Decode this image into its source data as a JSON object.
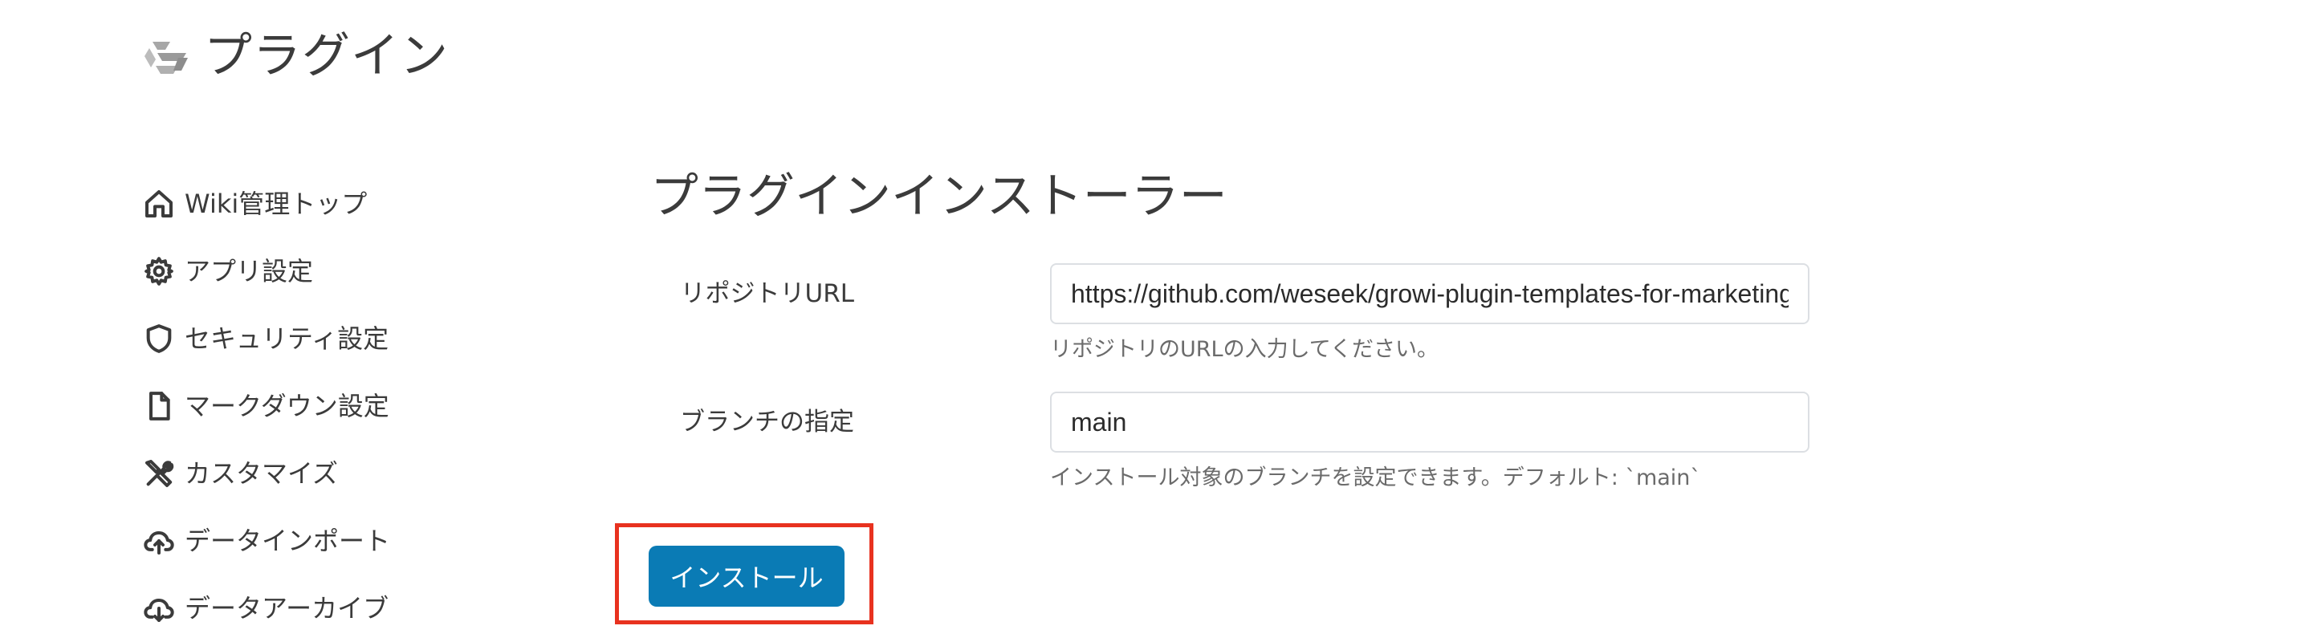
{
  "header": {
    "title": "プラグイン",
    "logo_icon": "growi-logo-icon"
  },
  "sidebar": {
    "items": [
      {
        "label": "Wiki管理トップ",
        "icon": "home-icon"
      },
      {
        "label": "アプリ設定",
        "icon": "gear-icon"
      },
      {
        "label": "セキュリティ設定",
        "icon": "shield-icon"
      },
      {
        "label": "マークダウン設定",
        "icon": "document-icon"
      },
      {
        "label": "カスタマイズ",
        "icon": "tools-icon"
      },
      {
        "label": "データインポート",
        "icon": "cloud-upload-icon"
      },
      {
        "label": "データアーカイブ",
        "icon": "cloud-download-icon"
      }
    ]
  },
  "main": {
    "section_title": "プラグインインストーラー",
    "repository": {
      "label": "リポジトリURL",
      "value": "https://github.com/weseek/growi-plugin-templates-for-marketing",
      "help": "リポジトリのURLの入力してください。"
    },
    "branch": {
      "label": "ブランチの指定",
      "value": "main",
      "help": "インストール対象のブランチを設定できます。デフォルト: `main`"
    },
    "install_button_label": "インストール"
  },
  "colors": {
    "primary": "#0a7bb5",
    "highlight": "#e8321f",
    "text": "#3b3b3b",
    "muted": "#6b6b6b",
    "border": "#dcdfe3"
  }
}
